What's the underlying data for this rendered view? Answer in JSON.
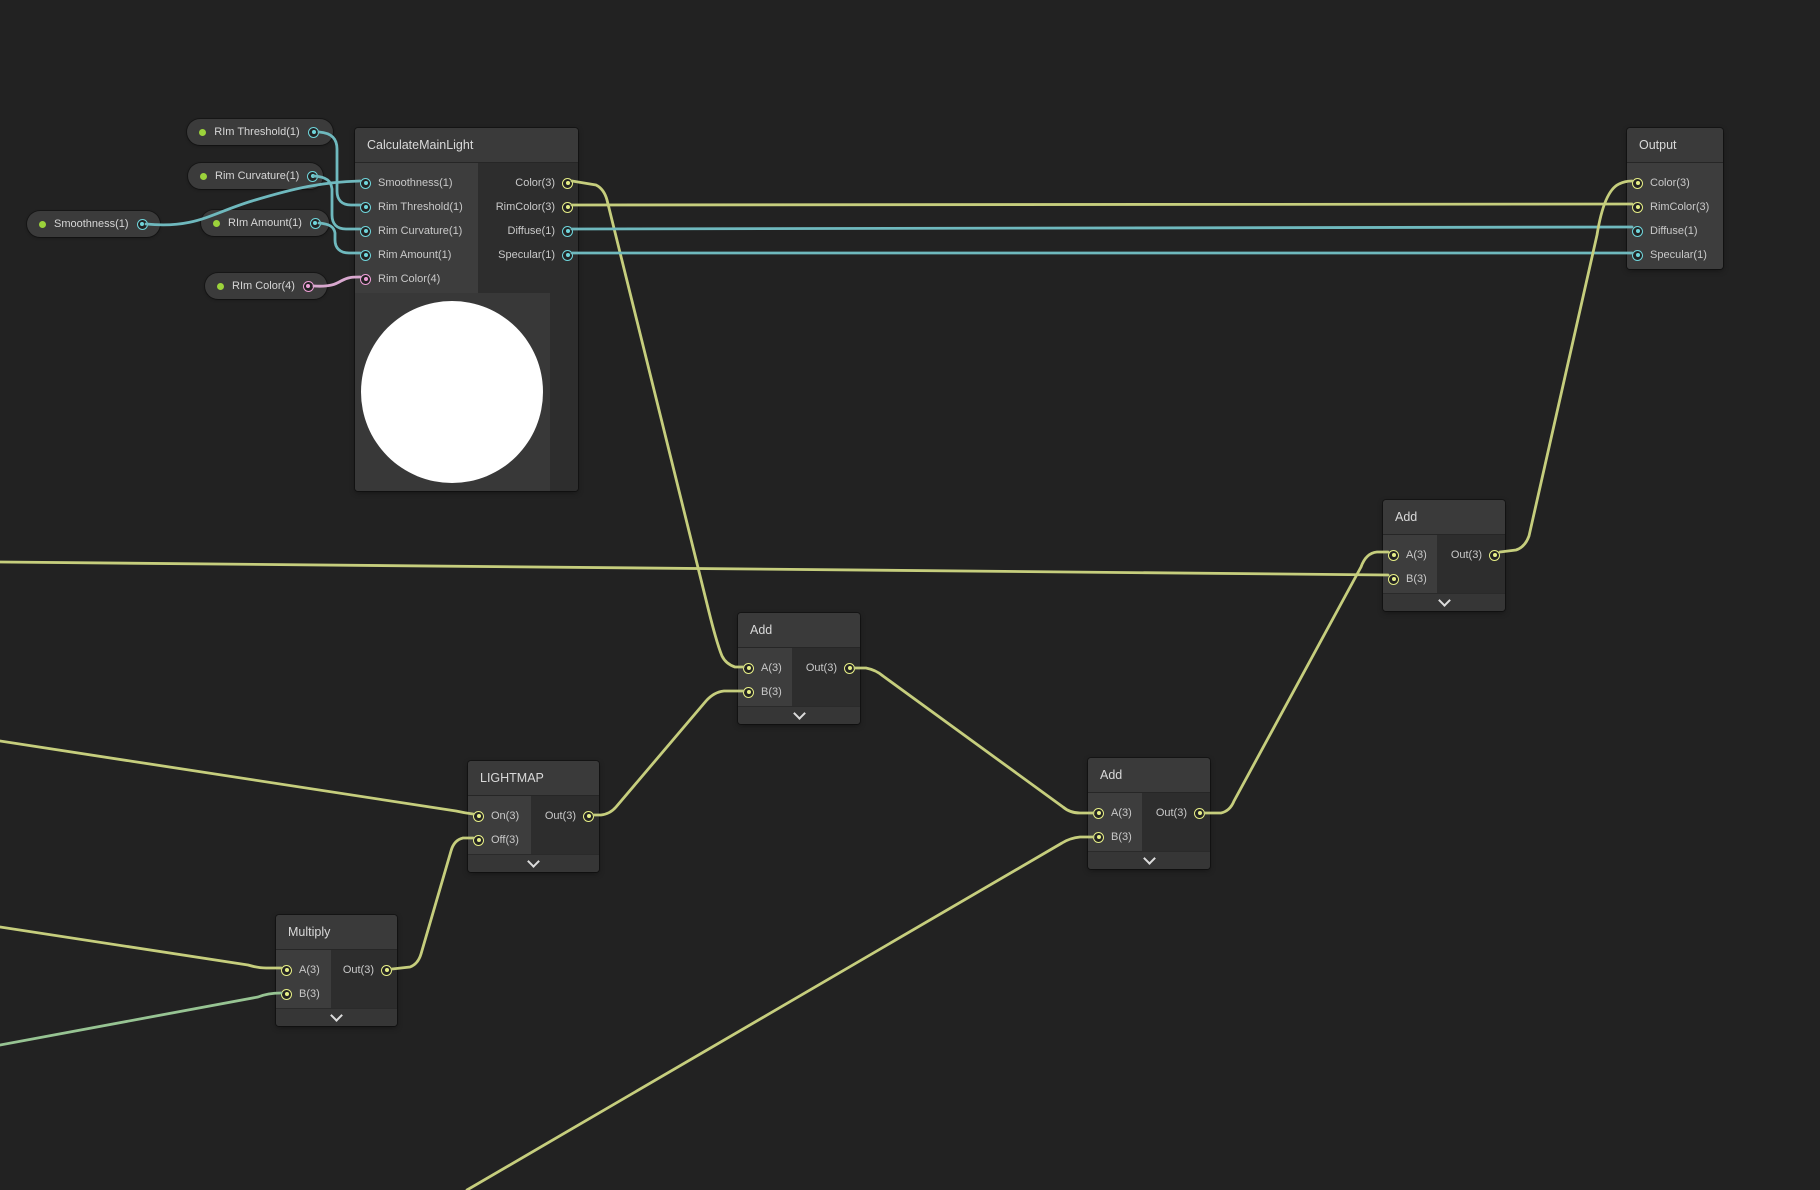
{
  "colors": {
    "port": {
      "float": "#6FD5DB",
      "vec3": "#E6EE86",
      "vec4": "#ED9ED6",
      "vec2": "#9CD39C"
    },
    "edge": {
      "float": "#6FB9BE",
      "vec3": "#C6CE7D",
      "vec4": "#D9A8CF",
      "vec2": "#97C493"
    },
    "property_dot": "#9CD33B",
    "canvas_background": "#222222"
  },
  "properties": [
    {
      "label": "RIm Threshold(1)",
      "type": "float"
    },
    {
      "label": "Rim Curvature(1)",
      "type": "float"
    },
    {
      "label": "Smoothness(1)",
      "type": "float"
    },
    {
      "label": "RIm Amount(1)",
      "type": "float"
    },
    {
      "label": "RIm Color(4)",
      "type": "vec4"
    }
  ],
  "nodes": {
    "calculate_main_light": {
      "title": "CalculateMainLight",
      "inputs": [
        {
          "label": "Smoothness(1)",
          "type": "float"
        },
        {
          "label": "Rim Threshold(1)",
          "type": "float"
        },
        {
          "label": "Rim Curvature(1)",
          "type": "float"
        },
        {
          "label": "Rim Amount(1)",
          "type": "float"
        },
        {
          "label": "Rim Color(4)",
          "type": "vec4"
        }
      ],
      "outputs": [
        {
          "label": "Color(3)",
          "type": "vec3"
        },
        {
          "label": "RimColor(3)",
          "type": "vec3"
        },
        {
          "label": "Diffuse(1)",
          "type": "float"
        },
        {
          "label": "Specular(1)",
          "type": "float"
        }
      ]
    },
    "output": {
      "title": "Output",
      "inputs": [
        {
          "label": "Color(3)",
          "type": "vec3"
        },
        {
          "label": "RimColor(3)",
          "type": "vec3"
        },
        {
          "label": "Diffuse(1)",
          "type": "float"
        },
        {
          "label": "Specular(1)",
          "type": "float"
        }
      ]
    },
    "add_center": {
      "title": "Add",
      "inputs": [
        {
          "label": "A(3)",
          "type": "vec3"
        },
        {
          "label": "B(3)",
          "type": "vec3"
        }
      ],
      "outputs": [
        {
          "label": "Out(3)",
          "type": "vec3"
        }
      ]
    },
    "add_upper": {
      "title": "Add",
      "inputs": [
        {
          "label": "A(3)",
          "type": "vec3"
        },
        {
          "label": "B(3)",
          "type": "vec3"
        }
      ],
      "outputs": [
        {
          "label": "Out(3)",
          "type": "vec3"
        }
      ]
    },
    "add_lower": {
      "title": "Add",
      "inputs": [
        {
          "label": "A(3)",
          "type": "vec3"
        },
        {
          "label": "B(3)",
          "type": "vec3"
        }
      ],
      "outputs": [
        {
          "label": "Out(3)",
          "type": "vec3"
        }
      ]
    },
    "lightmap": {
      "title": "LIGHTMAP",
      "inputs": [
        {
          "label": "On(3)",
          "type": "vec3"
        },
        {
          "label": "Off(3)",
          "type": "vec3"
        }
      ],
      "outputs": [
        {
          "label": "Out(3)",
          "type": "vec3"
        }
      ]
    },
    "multiply": {
      "title": "Multiply",
      "inputs": [
        {
          "label": "A(3)",
          "type": "vec3"
        },
        {
          "label": "B(3)",
          "type": "vec3"
        }
      ],
      "outputs": [
        {
          "label": "Out(3)",
          "type": "vec3"
        }
      ]
    }
  },
  "edges": [
    {
      "from": "property-smoothness",
      "to": "calculate-main-light-smoothness",
      "type": "float"
    },
    {
      "from": "property-rim-threshold",
      "to": "calculate-main-light-rim-threshold",
      "type": "float"
    },
    {
      "from": "property-rim-curvature",
      "to": "calculate-main-light-rim-curvature",
      "type": "float"
    },
    {
      "from": "property-rim-amount",
      "to": "calculate-main-light-rim-amount",
      "type": "float"
    },
    {
      "from": "property-rim-color",
      "to": "calculate-main-light-rim-color",
      "type": "vec4"
    },
    {
      "from": "calculate-main-light-color",
      "to": "add-center-a",
      "type": "vec3"
    },
    {
      "from": "calculate-main-light-rimcolor",
      "to": "output-rimcolor",
      "type": "vec3"
    },
    {
      "from": "calculate-main-light-diffuse",
      "to": "output-diffuse",
      "type": "float"
    },
    {
      "from": "calculate-main-light-specular",
      "to": "output-specular",
      "type": "float"
    },
    {
      "from": "offscreen-left",
      "to": "add-upper-b",
      "type": "vec3"
    },
    {
      "from": "offscreen-left",
      "to": "lightmap-on",
      "type": "vec3"
    },
    {
      "from": "offscreen-left",
      "to": "multiply-a",
      "type": "vec3"
    },
    {
      "from": "offscreen-left",
      "to": "multiply-b",
      "type": "vec2"
    },
    {
      "from": "offscreen-bottom",
      "to": "add-lower-b",
      "type": "vec3"
    },
    {
      "from": "multiply-out",
      "to": "lightmap-off",
      "type": "vec3"
    },
    {
      "from": "lightmap-out",
      "to": "add-center-b",
      "type": "vec3"
    },
    {
      "from": "add-center-out",
      "to": "add-lower-a",
      "type": "vec3"
    },
    {
      "from": "add-lower-out",
      "to": "add-upper-a",
      "type": "vec3"
    },
    {
      "from": "add-upper-out",
      "to": "output-color",
      "type": "vec3"
    }
  ]
}
